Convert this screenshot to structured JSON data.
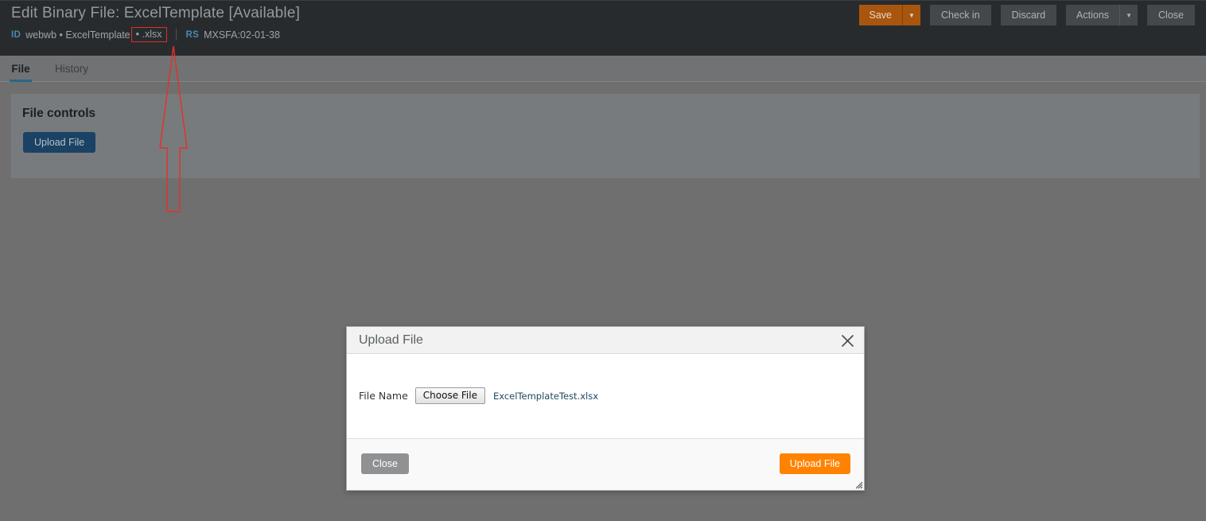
{
  "header": {
    "title": "Edit Binary File: ExcelTemplate [Available]",
    "meta": {
      "id_key": "ID",
      "id_value": "webwb • ExcelTemplate",
      "extension": "• .xlsx",
      "rs_key": "RS",
      "rs_value": "MXSFA:02-01-38"
    },
    "actions": {
      "save_label": "Save",
      "save_caret": "▼",
      "check_in_label": "Check in",
      "discard_label": "Discard",
      "actions_label": "Actions",
      "actions_caret": "▼",
      "close_label": "Close"
    }
  },
  "tabs": [
    {
      "label": "File",
      "active": true
    },
    {
      "label": "History",
      "active": false
    }
  ],
  "panel": {
    "heading": "File controls",
    "upload_button_label": "Upload File"
  },
  "modal": {
    "title": "Upload File",
    "close_icon": "close-icon",
    "file_name_label": "File Name",
    "choose_file_label": "Choose File",
    "chosen_file_name": "ExcelTemplateTest.xlsx",
    "footer_close_label": "Close",
    "footer_upload_label": "Upload File"
  },
  "annotation": {
    "type": "arrow-up",
    "target": "file extension .xlsx",
    "color": "#f5332a"
  },
  "colors": {
    "header_bg": "#2b2e31",
    "page_bg": "#767676",
    "panel_bg": "#808385",
    "tab_bar_bg": "#777a7c",
    "tab_active_underline": "#2e6d92",
    "primary_accent": "#b35c0e",
    "upload_blue": "#1c476b",
    "upload_orange": "#ff8200",
    "annotation_red": "#f5332a",
    "meta_key_blue": "#4f92b8"
  }
}
